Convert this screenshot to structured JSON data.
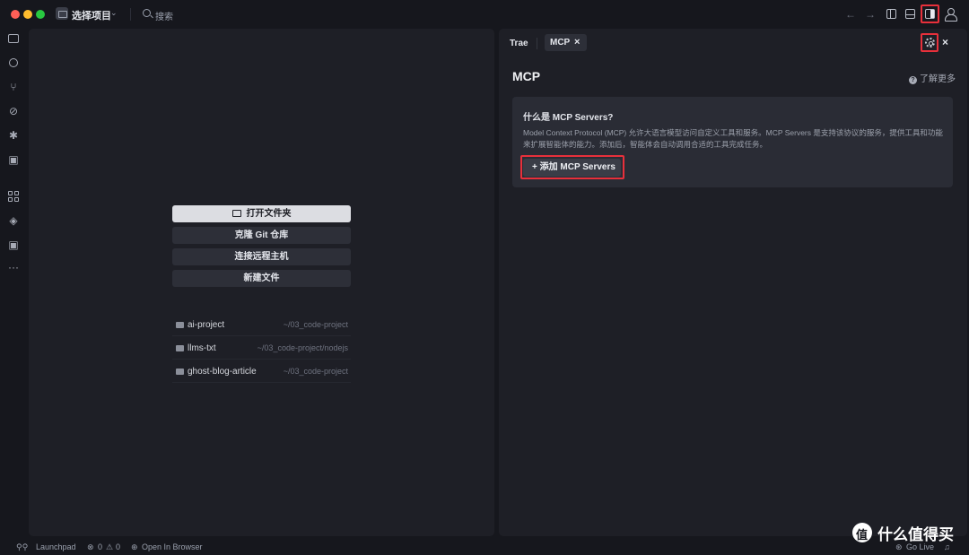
{
  "titlebar": {
    "project_label": "选择项目",
    "search_placeholder": "搜索"
  },
  "welcome": {
    "buttons": [
      "打开文件夹",
      "克隆 Git 仓库",
      "连接远程主机",
      "新建文件"
    ],
    "recent": [
      {
        "name": "ai-project",
        "path": "~/03_code-project"
      },
      {
        "name": "llms-txt",
        "path": "~/03_code-project/nodejs"
      },
      {
        "name": "ghost-blog-article",
        "path": "~/03_code-project"
      }
    ]
  },
  "panel": {
    "tabs": [
      {
        "label": "Trae"
      },
      {
        "label": "MCP"
      }
    ],
    "close_glyph": "×",
    "title": "MCP",
    "learn_more": "了解更多",
    "card": {
      "title": "什么是 MCP Servers?",
      "description": "Model Context Protocol (MCP) 允许大语言模型访问自定义工具和服务。MCP Servers 是支持该协议的服务，提供工具和功能来扩展智能体的能力。添加后，智能体会自动调用合适的工具完成任务。",
      "add_button": "+ 添加 MCP Servers"
    }
  },
  "statusbar": {
    "launchpad": "Launchpad",
    "errors": "0",
    "warnings": "0",
    "open_in_browser": "Open In Browser",
    "go_live": "Go Live"
  },
  "watermark": {
    "text": "什么值得买"
  },
  "colors": {
    "highlight_frame": "#e8303b",
    "background": "#16171d",
    "pane": "#1e1f26"
  }
}
